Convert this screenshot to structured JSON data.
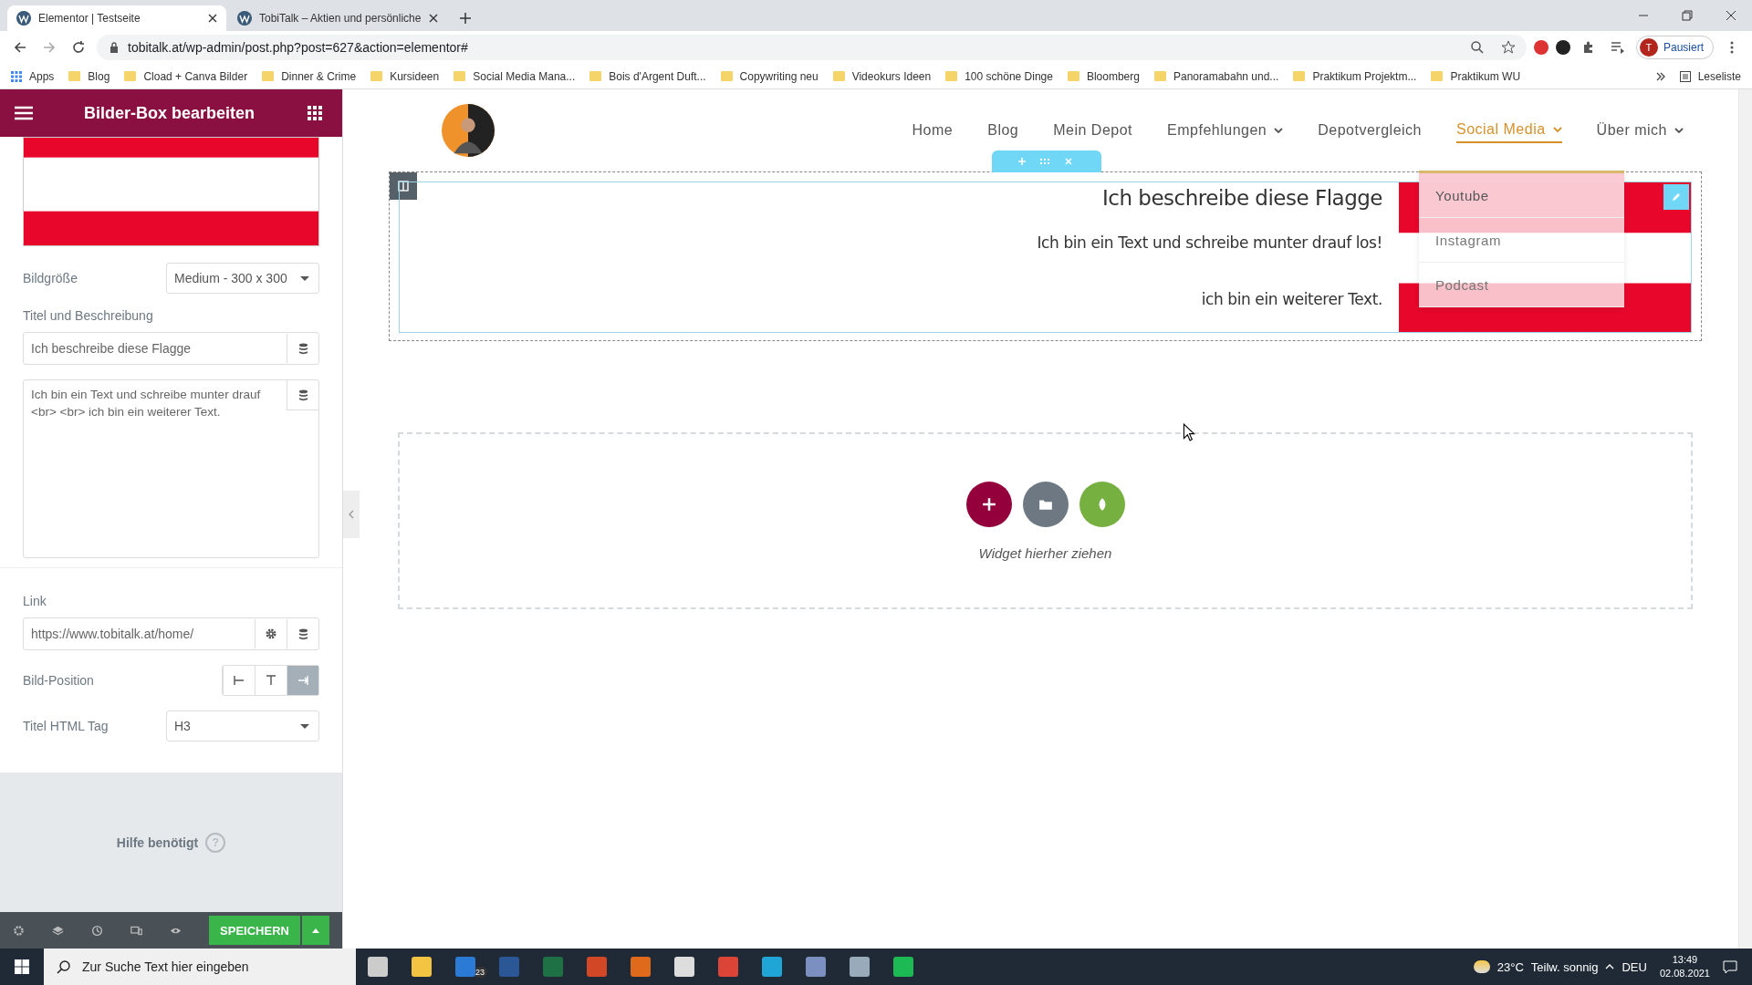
{
  "browser": {
    "tabs": [
      {
        "title": "Elementor | Testseite",
        "selected": true
      },
      {
        "title": "TobiTalk – Aktien und persönliche",
        "selected": false
      }
    ],
    "url": "tobitalk.at/wp-admin/post.php?post=627&action=elementor#",
    "profile": "Pausiert",
    "profile_initial": "T",
    "apps": "Apps",
    "bookmarks": [
      "Blog",
      "Cload + Canva Bilder",
      "Dinner & Crime",
      "Kursideen",
      "Social Media Mana...",
      "Bois d'Argent Duft...",
      "Copywriting neu",
      "Videokurs Ideen",
      "100 schöne Dinge",
      "Bloomberg",
      "Panoramabahn und...",
      "Praktikum Projektm...",
      "Praktikum WU"
    ],
    "reading_list": "Leseliste"
  },
  "editor": {
    "title": "Bilder-Box bearbeiten",
    "image_size": {
      "label": "Bildgröße",
      "value": "Medium - 300 x 300"
    },
    "title_section": "Titel und Beschreibung",
    "title_value": "Ich beschreibe diese Flagge",
    "description_value": "Ich bin ein Text und schreibe munter drauf <br> <br> ich bin ein weiterer Text.",
    "link": {
      "label": "Link",
      "value": "https://www.tobitalk.at/home/"
    },
    "image_position": {
      "label": "Bild-Position",
      "options": [
        {
          "selected": false
        },
        {
          "selected": false
        },
        {
          "selected": true
        }
      ]
    },
    "html_tag": {
      "label": "Titel HTML Tag",
      "value": "H3"
    },
    "help": "Hilfe benötigt",
    "help_icon": "?",
    "save": "SPEICHERN"
  },
  "preview": {
    "nav": [
      {
        "label": "Home",
        "selected": false,
        "caret": false
      },
      {
        "label": "Blog",
        "selected": false,
        "caret": false
      },
      {
        "label": "Mein Depot",
        "selected": false,
        "caret": false
      },
      {
        "label": "Empfehlungen",
        "selected": false,
        "caret": true
      },
      {
        "label": "Depotvergleich",
        "selected": false,
        "caret": false
      },
      {
        "label": "Social Media",
        "selected": true,
        "caret": true
      },
      {
        "label": "Über mich",
        "selected": false,
        "caret": true
      }
    ],
    "submenu": [
      {
        "label": "Youtube",
        "selected": true
      },
      {
        "label": "Instagram",
        "selected": false
      },
      {
        "label": "Podcast",
        "selected": false
      }
    ],
    "box_title": "Ich beschreibe diese Flagge",
    "box_lines": [
      "Ich bin ein Text und schreibe munter drauf los!",
      "ich bin ein weiterer Text."
    ],
    "drop_hint": "Widget hierher ziehen"
  },
  "taskbar": {
    "search_placeholder": "Zur Suche Text hier eingeben",
    "mail_badge": "23",
    "temperature": "23°C",
    "weather": "Teilw. sonnig",
    "language": "DEU",
    "time": "13:49",
    "date": "02.08.2021"
  }
}
